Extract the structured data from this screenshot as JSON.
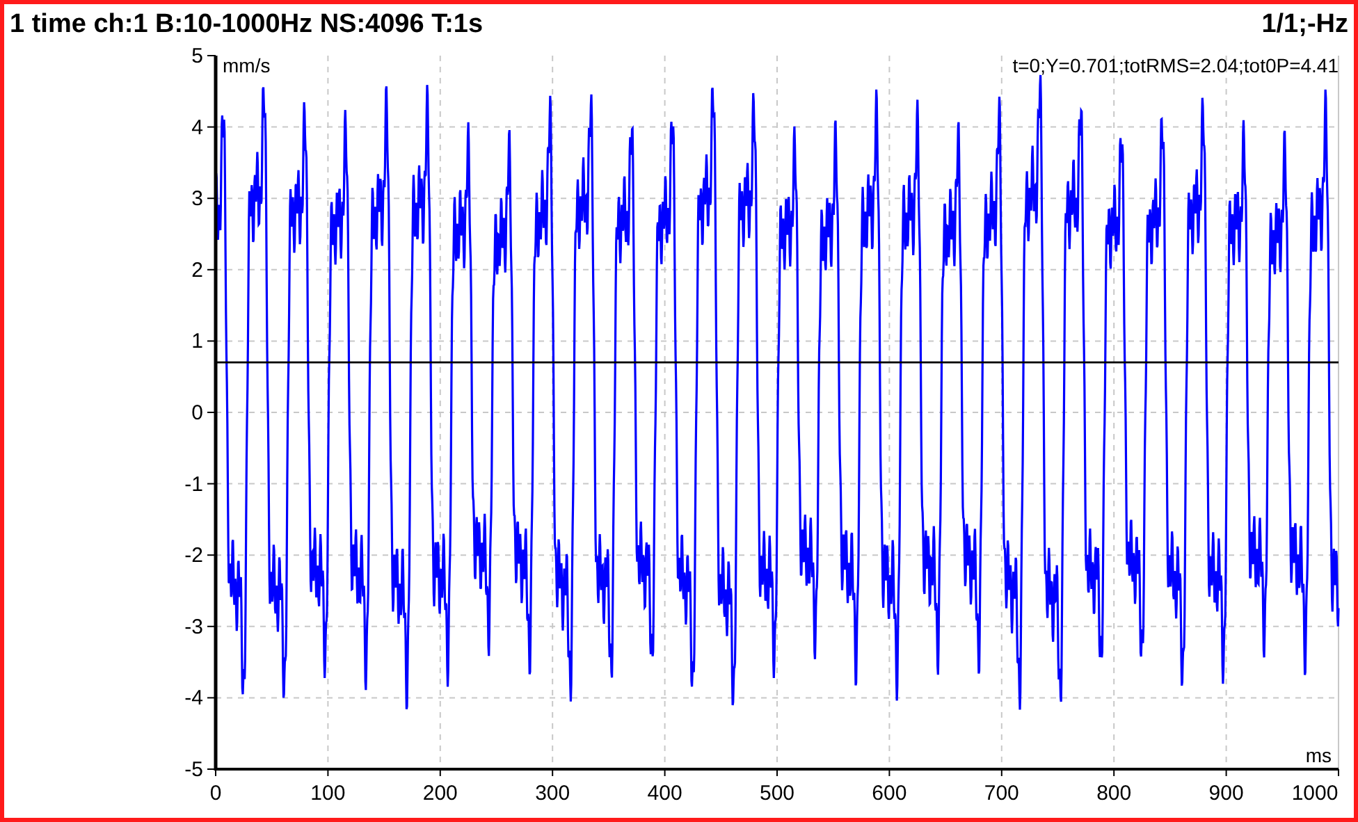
{
  "header": {
    "title": "1 time ch:1 B:10-1000Hz NS:4096 T:1s",
    "page": "1/1;-Hz"
  },
  "plot": {
    "readout": "t=0;Y=0.701;totRMS=2.04;tot0P=4.41",
    "y_unit": "mm/s",
    "x_unit": "ms",
    "y_ticks": [
      "5",
      "4",
      "3",
      "2",
      "1",
      "0",
      "-1",
      "-2",
      "-3",
      "-4",
      "-5"
    ],
    "x_ticks": [
      "0",
      "100",
      "200",
      "300",
      "400",
      "500",
      "600",
      "700",
      "800",
      "900",
      "1000"
    ]
  }
}
